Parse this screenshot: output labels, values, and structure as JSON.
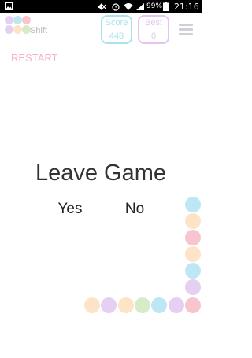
{
  "status_bar": {
    "battery_percent": "99%",
    "time": "21:16",
    "icons": [
      "image-icon",
      "mute-icon",
      "alarm-icon",
      "wifi-icon",
      "signal-icon",
      "battery-icon"
    ]
  },
  "header": {
    "app_title": "Shift",
    "score": {
      "label": "Score",
      "value": "448",
      "color": "#a8e2ef"
    },
    "best": {
      "label": "Best",
      "value": "0",
      "color": "#e3c5ef"
    },
    "menu_icon": "hamburger-menu-icon"
  },
  "restart_label": "RESTART",
  "dialog": {
    "title": "Leave Game",
    "yes_label": "Yes",
    "no_label": "No"
  },
  "colors": {
    "blue": "#bde7f4",
    "pink": "#f8c4cd",
    "peach": "#fde4c6",
    "lavender": "#e5cff3",
    "green": "#d8ebc8"
  },
  "logo_dots": [
    "lavender",
    "blue",
    "pink",
    "lavender",
    "peach",
    "green"
  ],
  "board": {
    "right_column": [
      "blue",
      "peach",
      "pink",
      "peach",
      "blue",
      "lavender"
    ],
    "bottom_row": [
      "peach",
      "lavender",
      "peach",
      "green",
      "blue",
      "lavender",
      "pink"
    ]
  }
}
